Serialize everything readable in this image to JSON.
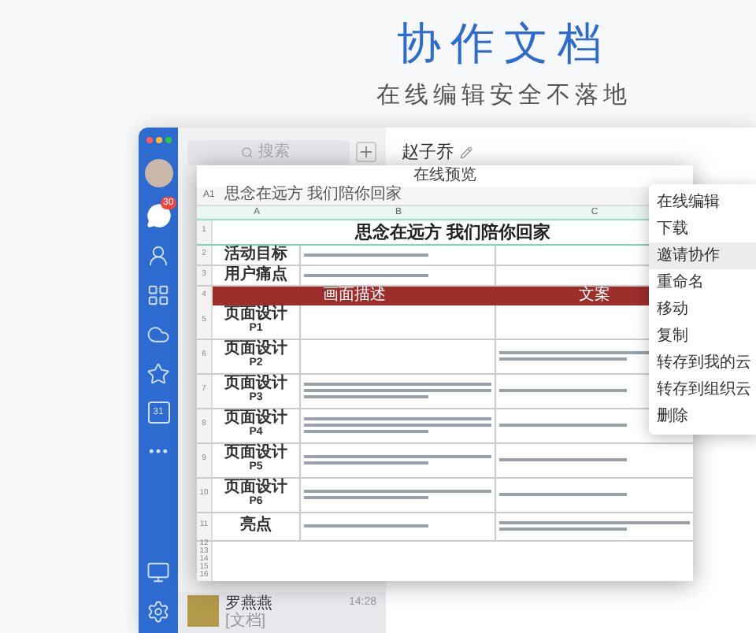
{
  "hero": {
    "title": "协作文档",
    "subtitle": "在线编辑安全不落地"
  },
  "sidebar": {
    "badge": "30",
    "calendar_day": "31"
  },
  "list": {
    "search": {
      "placeholder": "搜索"
    },
    "contact": {
      "name": "罗燕燕",
      "time": "14:28",
      "preview": "[文档]"
    }
  },
  "chat": {
    "title": "赵子乔"
  },
  "preview": {
    "title": "在线预览",
    "cell_ref": "A1",
    "formula": "思念在远方 我们陪你回家",
    "columns": [
      "A",
      "B",
      "C"
    ],
    "rows": [
      {
        "num": "1",
        "kind": "title",
        "text": "思念在远方 我们陪你回家"
      },
      {
        "num": "2",
        "kind": "text",
        "label": "活动目标"
      },
      {
        "num": "3",
        "kind": "text",
        "label": "用户痛点"
      },
      {
        "num": "4",
        "kind": "band",
        "cells": [
          "画面描述",
          "文案"
        ]
      },
      {
        "num": "5",
        "kind": "design",
        "label": "页面设计",
        "sub": "P1"
      },
      {
        "num": "6",
        "kind": "design",
        "label": "页面设计",
        "sub": "P2"
      },
      {
        "num": "7",
        "kind": "design",
        "label": "页面设计",
        "sub": "P3"
      },
      {
        "num": "8",
        "kind": "design",
        "label": "页面设计",
        "sub": "P4"
      },
      {
        "num": "9",
        "kind": "design",
        "label": "页面设计",
        "sub": "P5"
      },
      {
        "num": "10",
        "kind": "design",
        "label": "页面设计",
        "sub": "P6"
      },
      {
        "num": "11",
        "kind": "text",
        "label": "亮点"
      },
      {
        "num": "12",
        "kind": "empty"
      },
      {
        "num": "13",
        "kind": "empty"
      },
      {
        "num": "14",
        "kind": "empty"
      },
      {
        "num": "15",
        "kind": "empty"
      },
      {
        "num": "16",
        "kind": "empty"
      }
    ]
  },
  "menu": [
    {
      "label": "在线编辑",
      "selected": false
    },
    {
      "label": "下载",
      "selected": false
    },
    {
      "label": "邀请协作",
      "selected": true
    },
    {
      "label": "重命名",
      "selected": false
    },
    {
      "label": "移动",
      "selected": false
    },
    {
      "label": "复制",
      "selected": false
    },
    {
      "label": "转存到我的云",
      "selected": false
    },
    {
      "label": "转存到组织云",
      "selected": false
    },
    {
      "label": "删除",
      "selected": false
    }
  ]
}
